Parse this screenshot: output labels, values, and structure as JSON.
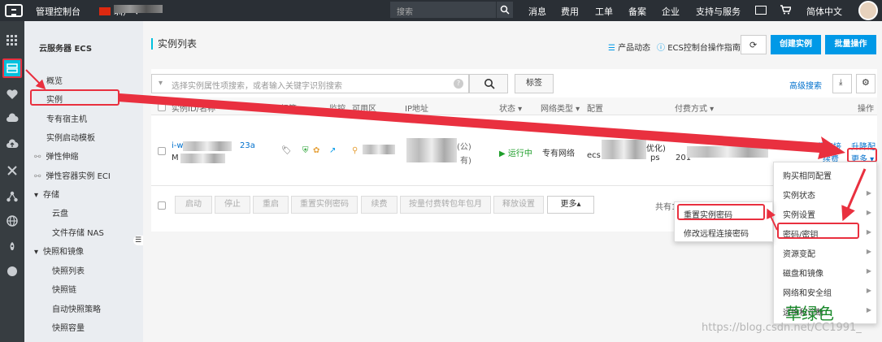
{
  "topbar": {
    "console": "管理控制台",
    "region_suffix": "圳）",
    "search_placeholder": "搜索",
    "nav": [
      "消息",
      "费用",
      "工单",
      "备案",
      "企业",
      "支持与服务"
    ],
    "lang": "简体中文"
  },
  "sidebar": {
    "title": "云服务器 ECS",
    "items": {
      "overview": "概览",
      "instances": "实例",
      "dedicated": "专有宿主机",
      "launch_tpl": "实例启动模板",
      "autoscale": "弹性伸缩",
      "eci": "弹性容器实例 ECI",
      "storage": "存储",
      "disk": "云盘",
      "nas": "文件存储 NAS",
      "snap": "快照和镜像",
      "snap_list": "快照列表",
      "snap_chain": "快照链",
      "auto_snap": "自动快照策略",
      "snap_cap": "快照容量"
    }
  },
  "header": {
    "title": "实例列表",
    "news": "产品动态",
    "guide": "ECS控制台操作指南",
    "create": "创建实例",
    "batch": "批量操作"
  },
  "search": {
    "placeholder": "选择实例属性项搜索，或者输入关键字识别搜索",
    "tag": "标签",
    "advanced": "高级搜索"
  },
  "table": {
    "headers": {
      "id": "实例ID/名称",
      "tag": "标签",
      "monitor": "监控",
      "zone": "可用区",
      "ip": "IP地址",
      "status": "状态",
      "network": "网络类型",
      "config": "配置",
      "pay": "付费方式",
      "action": "操作"
    },
    "row": {
      "id_prefix": "i-w",
      "id_suffix": "23a",
      "name_prefix": "M",
      "ip_frag1": "(公)",
      "ip_frag2": "有)",
      "status": "运行中",
      "network": "专有网络",
      "config_prefix": "ecs",
      "config_frag1": "优化)",
      "config_frag2": "ps",
      "pay_year": "201",
      "act_manage": "管理",
      "act_remote": "远程连接",
      "act_upgrade": "升降配",
      "act_renew": "续费",
      "act_more": "更多"
    }
  },
  "bottom": {
    "buttons": [
      "启动",
      "停止",
      "重启",
      "重置实例密码",
      "续费",
      "按量付费转包年包月",
      "释放设置"
    ],
    "more": "更多▴",
    "total": "共有1条，每页显示："
  },
  "menu_main": {
    "items": [
      "购买相同配置",
      "实例状态",
      "实例设置",
      "密码/密钥",
      "资源变配",
      "磁盘和镜像",
      "网络和安全组",
      "运维和诊断"
    ]
  },
  "menu_sub": {
    "items": [
      "重置实例密码",
      "修改远程连接密码"
    ]
  },
  "watermark": {
    "text": "草绿色",
    "url": "https://blog.csdn.net/CC1991_"
  },
  "colors": {
    "accent": "#0099e7",
    "highlight": "#e9303f",
    "status_ok": "#1e9e2a"
  }
}
